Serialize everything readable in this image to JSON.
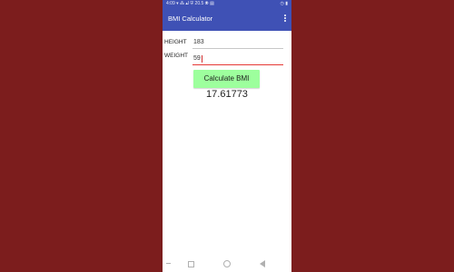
{
  "status_bar": {
    "left_text": "4:09 ▾ ⁂ ▴l ⛨ 20.5 ⦿ ▤",
    "right_text": "◷ ▮"
  },
  "app_bar": {
    "title": "BMI Calculator",
    "menu_icon": "overflow-icon"
  },
  "form": {
    "height_label": "HEIGHT",
    "height_value": "183",
    "weight_label": "WEIGHT",
    "weight_value": "59"
  },
  "action": {
    "label": "Calculate BMI"
  },
  "result": {
    "value": "17.61773"
  },
  "nav": {
    "menu_icon": "menu-icon",
    "recents_icon": "square-icon",
    "home_icon": "circle-icon",
    "back_icon": "back-icon"
  },
  "colors": {
    "background": "#7c1d1d",
    "app_bar": "#3f51b5",
    "button": "#9dff9d",
    "active_underline": "#e53935"
  }
}
